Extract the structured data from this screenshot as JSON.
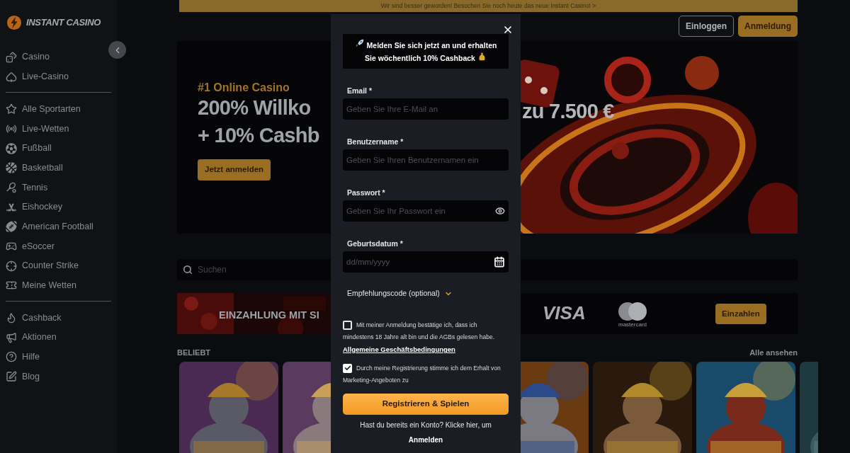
{
  "announcement": "Wir sind besser geworden! Besuchen Sie noch heute das neue Instant Casino! >",
  "logo": {
    "text": "INSTANT CASINO"
  },
  "sidebar": {
    "groups": [
      [
        {
          "label": "Casino"
        },
        {
          "label": "Live-Casino"
        }
      ],
      [
        {
          "label": "Alle Sportarten"
        },
        {
          "label": "Live-Wetten"
        },
        {
          "label": "Fußball"
        },
        {
          "label": "Basketball"
        },
        {
          "label": "Tennis"
        },
        {
          "label": "Eishockey"
        },
        {
          "label": "American Football"
        },
        {
          "label": "eSoccer"
        },
        {
          "label": "Counter Strike"
        },
        {
          "label": "Meine Wetten"
        }
      ],
      [
        {
          "label": "Cashback"
        },
        {
          "label": "Aktionen"
        },
        {
          "label": "Hilfe"
        },
        {
          "label": "Blog"
        }
      ]
    ]
  },
  "header": {
    "buttons": [
      {
        "label": "Einloggen",
        "kind": "outline"
      },
      {
        "label": "Anmeldung",
        "kind": "primary"
      }
    ]
  },
  "hero": {
    "kicker": "#1 Online Casino",
    "title_lines": [
      "200% Willko",
      "+ 10% Cashb"
    ],
    "title_right": "zu 7.500 €",
    "button": "Jetzt anmelden"
  },
  "search": {
    "placeholder": "Suchen"
  },
  "deposit_banner": {
    "text": "EINZAHLUNG MIT SI",
    "visa": "VISA",
    "mastercard": "mastercard",
    "button": "Einzahlen"
  },
  "section": {
    "title": "BELIEBT",
    "link": "Alle ansehen"
  },
  "modal": {
    "promo_lines": [
      "Melden Sie sich jetzt an und erhalten",
      "Sie wöchentlich 10% Cashback"
    ],
    "fields": [
      {
        "label": "Email *",
        "placeholder": "Geben Sie Ihre E-Mail an",
        "kind": "text"
      },
      {
        "label": "Benutzername *",
        "placeholder": "Geben Sie Ihren Benutzernamen ein",
        "kind": "text"
      },
      {
        "label": "Passwort *",
        "placeholder": "Geben Sie Ihr Passwort ein",
        "kind": "password"
      },
      {
        "label": "Geburtsdatum *",
        "placeholder": "dd/mm/yyyy",
        "kind": "date"
      }
    ],
    "referral": {
      "label": "Empfehlungscode (optional)",
      "expanded": false
    },
    "consents": [
      {
        "first_line": "Mit meiner Anmeldung bestätige ich, dass ich",
        "rest": "mindestens 18 Jahre alt bin und die AGBs gelesen habe.",
        "link": "Allgemeine Geschäftsbedingungen",
        "checked": false
      },
      {
        "first_line": "Durch meine Registrierung stimme ich dem Erhalt von",
        "rest": "Marketing-Angeboten zu",
        "checked": true
      }
    ],
    "submit": "Registrieren & Spielen",
    "footer": "Hast du bereits ein Konto? Klicke hier, um",
    "footer_link": "Anmelden"
  }
}
